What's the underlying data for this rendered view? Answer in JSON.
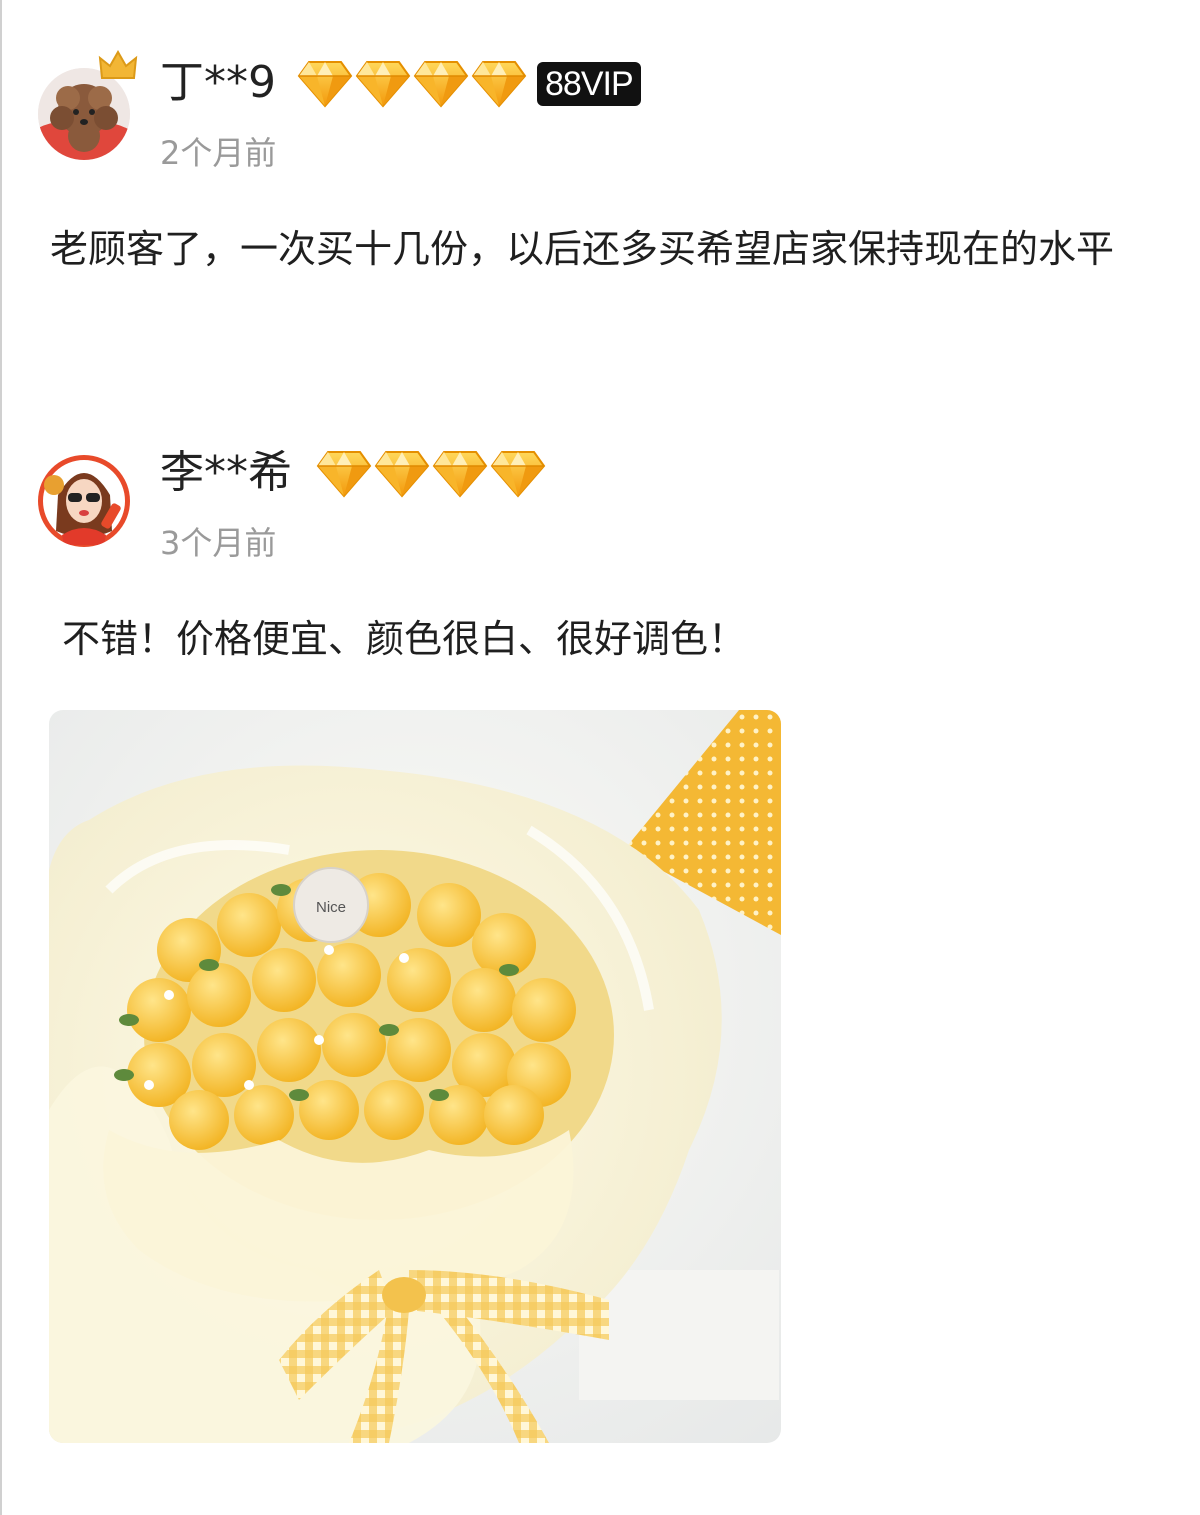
{
  "reviews": [
    {
      "username": "丁**9",
      "vip_badge": "88VIP",
      "time": "2个月前",
      "content": "老顾客了，一次买十几份，以后还多买希望店家保持现在的水平",
      "diamond_count": 4,
      "avatar_icon": "poodle-avatar"
    },
    {
      "username": "李**希",
      "time": "3个月前",
      "content": "不错！价格便宜、颜色很白、很好调色！",
      "diamond_count": 4,
      "avatar_icon": "cartoon-girl-avatar",
      "photo": {
        "label": "Nice",
        "description_icon": "tulip-cake-photo"
      }
    }
  ],
  "colors": {
    "diamond": "#f7b321",
    "vip_bg": "#111111",
    "time": "#9a9a9a"
  }
}
